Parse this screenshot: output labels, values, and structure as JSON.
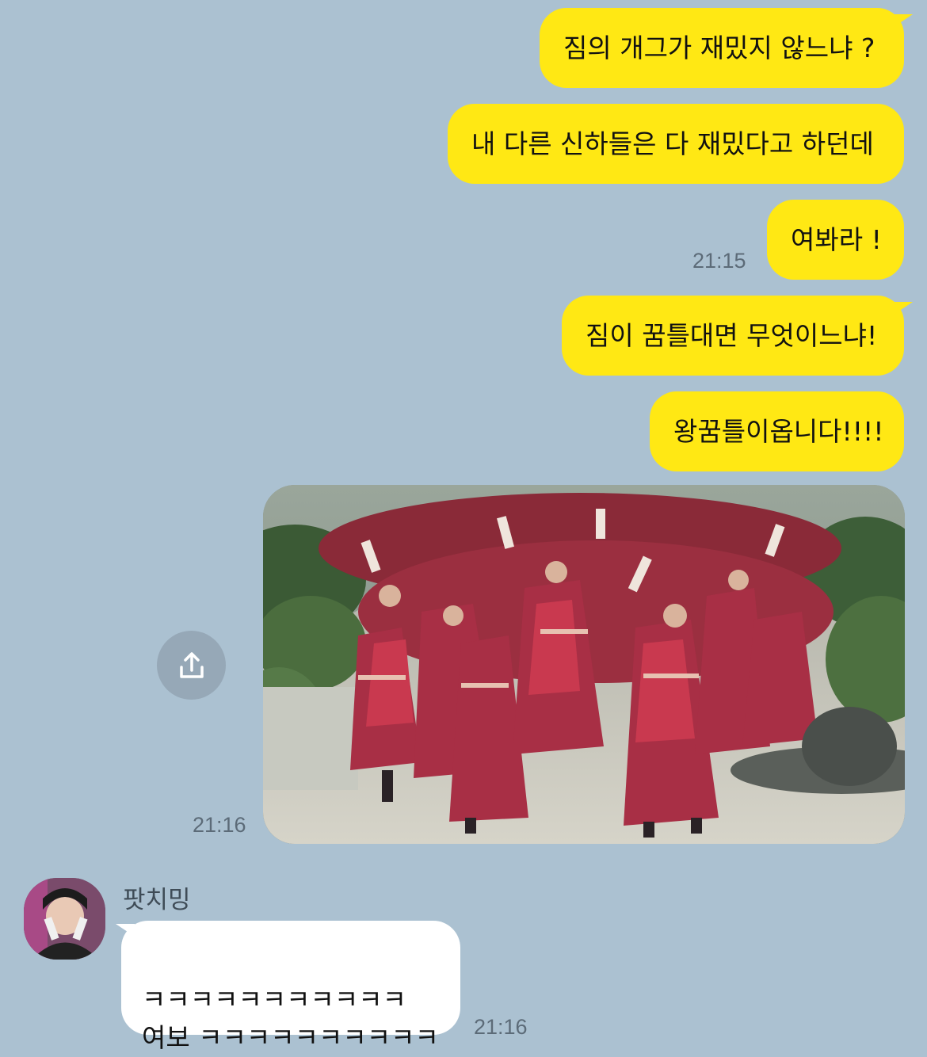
{
  "messages_out": [
    {
      "text": "짐의 개그가 재밌지 않느냐 ?"
    },
    {
      "text": "내 다른 신하들은 다 재밌다고 하던데"
    },
    {
      "text": "여봐라 !",
      "time": "21:15"
    },
    {
      "text": "짐이 꿈틀대면 무엇이느냐!"
    },
    {
      "text": "왕꿈틀이옵니다!!!!"
    }
  ],
  "media_message": {
    "time": "21:16",
    "share_icon": "share-icon"
  },
  "incoming": {
    "sender": "팟치밍",
    "text": "ㅋㅋㅋㅋㅋㅋㅋㅋㅋㅋㅋ\n여보 ㅋㅋㅋㅋㅋㅋㅋㅋㅋㅋ",
    "time": "21:16"
  },
  "colors": {
    "background": "#abc1d1",
    "outgoing_bubble": "#ffe814",
    "incoming_bubble": "#ffffff"
  }
}
